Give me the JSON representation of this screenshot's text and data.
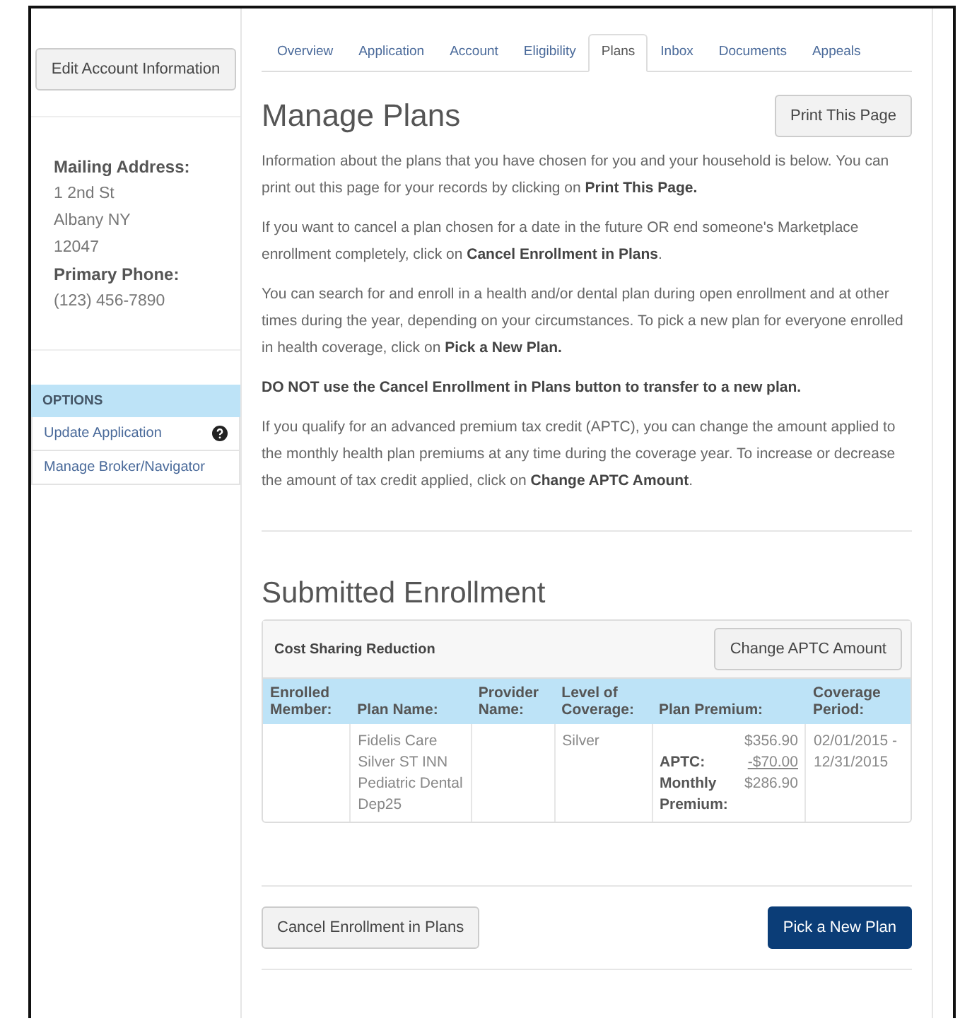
{
  "sidebar": {
    "edit_button": "Edit Account Information",
    "address_label": "Mailing Address:",
    "address_lines": [
      "1 2nd St",
      "Albany NY",
      "12047"
    ],
    "phone_label": "Primary Phone:",
    "phone": "(123) 456-7890",
    "options_header": "OPTIONS",
    "options": [
      {
        "label": "Update Application",
        "help": true
      },
      {
        "label": "Manage Broker/Navigator",
        "help": false
      }
    ]
  },
  "tabs": [
    {
      "label": "Overview",
      "selected": false
    },
    {
      "label": "Application",
      "selected": false
    },
    {
      "label": "Account",
      "selected": false
    },
    {
      "label": "Eligibility",
      "selected": false
    },
    {
      "label": "Plans",
      "selected": true
    },
    {
      "label": "Inbox",
      "selected": false
    },
    {
      "label": "Documents",
      "selected": false
    },
    {
      "label": "Appeals",
      "selected": false
    }
  ],
  "title": "Manage Plans",
  "print_button": "Print This Page",
  "paragraphs": [
    "Information about the plans that you have chosen for you and your household is below. You can print out this page for your records by clicking on **Print This Page.**",
    "If you want to cancel a plan chosen for a date in the future OR end someone's Marketplace enrollment completely, click on **Cancel Enrollment in Plans**.",
    "You can search for and enroll in a health and/or dental plan during open enrollment and at other times during the year, depending on your circumstances. To pick a new plan for everyone enrolled in health coverage, click on **Pick a New Plan.**",
    "**DO NOT use the Cancel Enrollment in Plans button to transfer to a new plan.**",
    "If you qualify for an advanced premium tax credit (APTC), you can change the amount applied to the monthly health plan premiums at any time during the coverage year. To increase or decrease the amount of tax credit applied, click on **Change APTC Amount**."
  ],
  "enrollment": {
    "title": "Submitted Enrollment",
    "panel_title": "Cost Sharing Reduction",
    "change_button": "Change APTC Amount",
    "columns": [
      "Enrolled Member:",
      "Plan Name:",
      "Provider Name:",
      "Level of Coverage:",
      "Plan Premium:",
      "Coverage Period:"
    ],
    "rows": [
      {
        "plan_name": "Fidelis Care Silver ST INN Pediatric Dental Dep25",
        "level": "Silver",
        "premium": "$356.90",
        "aptc_label": "APTC:",
        "aptc": "-$70.00",
        "monthly_label": "Monthly Premium:",
        "monthly": "$286.90",
        "period": "02/01/2015 - 12/31/2015"
      }
    ]
  },
  "cancel_button": "Cancel Enrollment in Plans",
  "pick_button": "Pick a New Plan"
}
